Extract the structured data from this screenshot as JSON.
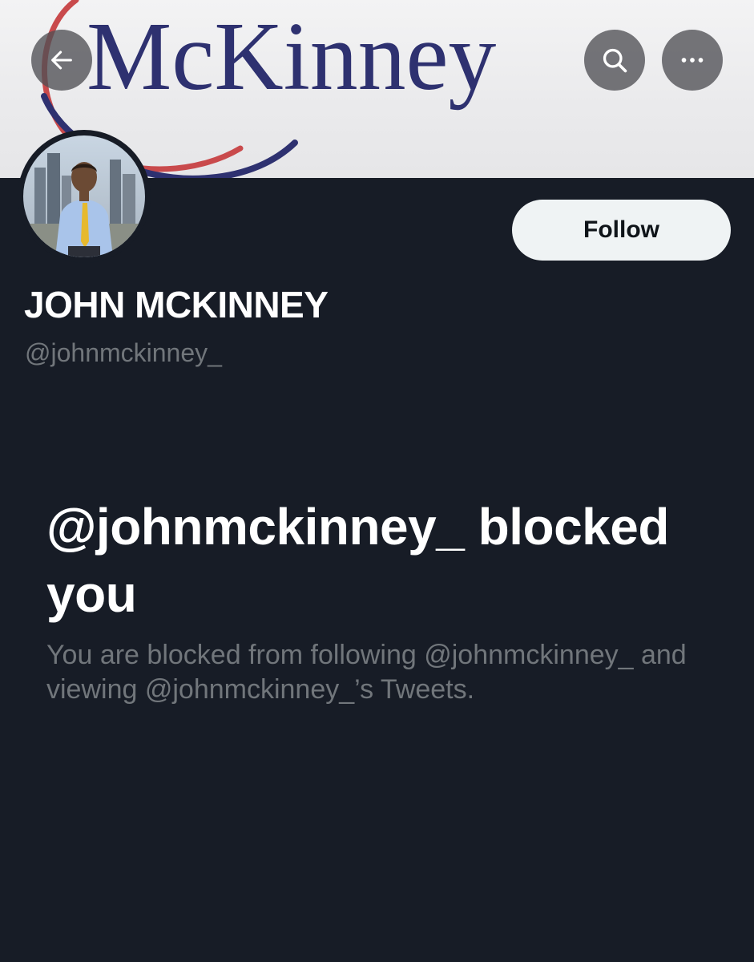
{
  "banner": {
    "logo_text": "McKinney",
    "colors": {
      "navy": "#2e3170",
      "red": "#c94a4c",
      "background": "#eeeeef"
    }
  },
  "top_bar": {
    "back_icon": "arrow-left-icon",
    "search_icon": "search-icon",
    "more_icon": "more-horizontal-icon"
  },
  "profile": {
    "display_name": "JOHN MCKINNEY",
    "handle": "@johnmckinney_",
    "follow_label": "Follow"
  },
  "blocked": {
    "title": "@johnmckinney_ blocked you",
    "description": "You are blocked from following @johnmckinney_ and viewing @johnmckinney_’s Tweets."
  },
  "theme": {
    "background": "#171c26",
    "text_primary": "#ffffff",
    "text_secondary": "#71767b",
    "button_bg": "#eff3f4"
  }
}
